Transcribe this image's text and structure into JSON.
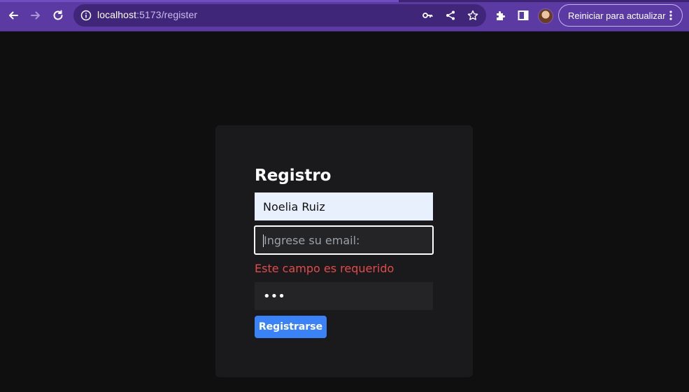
{
  "browser": {
    "url_host": "localhost",
    "url_path": ":5173/register",
    "update_button_label": "Reiniciar para actualizar",
    "icons": [
      "back-icon",
      "forward-icon",
      "reload-icon",
      "site-info-icon",
      "key-icon",
      "share-icon",
      "star-icon",
      "extensions-icon",
      "side-panel-icon",
      "profile-avatar",
      "more-icon"
    ]
  },
  "form": {
    "title": "Registro",
    "name_value": "Noelia Ruiz",
    "email_placeholder": "Ingrese su email:",
    "email_error": "Este campo es requerido",
    "password_masked": "•••",
    "submit_label": "Registrarse"
  },
  "colors": {
    "chrome": "#5b3ba3",
    "page_bg": "#0f0f0f",
    "card_bg": "#1a1a1c",
    "error": "#e24b4b",
    "primary_button": "#3b82f6"
  }
}
